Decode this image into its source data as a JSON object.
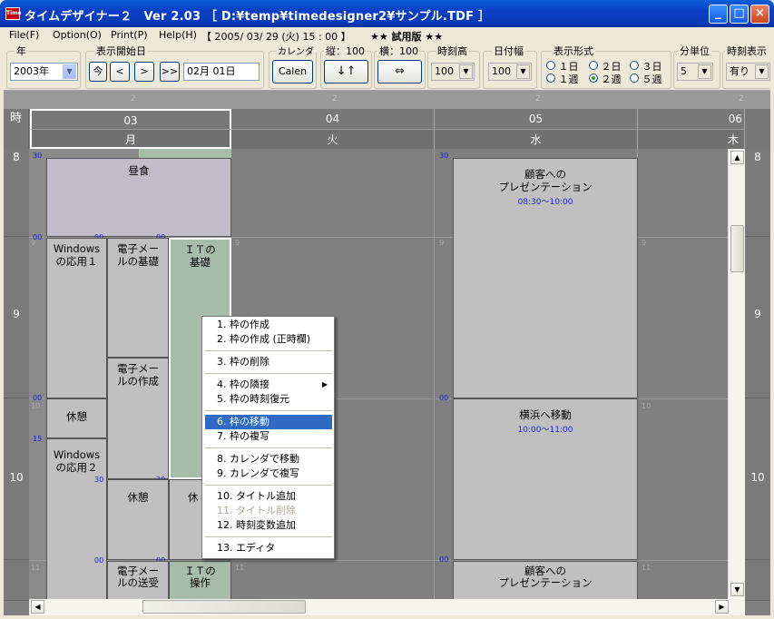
{
  "window": {
    "title": "タイムデザイナー２　Ver 2.03 ［ D:¥temp¥timedesigner2¥サンプル.TDF ］",
    "icon_text": "Time"
  },
  "menu": {
    "file": "File(F)",
    "option": "Option(O)",
    "print": "Print(P)",
    "help": "Help(H)",
    "datetime": "【 2005/ 03/ 29 (火) 15 : 00 】",
    "trial": "★★ 試用版 ★★"
  },
  "toolbar": {
    "year_label": "年",
    "year_value": "2003年",
    "start_label": "表示開始日",
    "today_btn": "今",
    "prev_btn": "<",
    "next_btn": ">",
    "jump_btn": ">>",
    "start_value": "02月 01日",
    "calendar_label": "カレンダ",
    "calendar_btn": "Calen",
    "vertical_label": "縦：100",
    "vertical_btn": "↓↑",
    "horizontal_label": "横：100",
    "horizontal_btn": "⇔",
    "timeheight_label": "時刻高",
    "timeheight_value": "100",
    "datewidth_label": "日付幅",
    "datewidth_value": "100",
    "display_label": "表示形式",
    "opt_1day": "１日",
    "opt_2day": "２日",
    "opt_3day": "３日",
    "opt_1week": "１週",
    "opt_2week": "２週",
    "opt_5week": "５週",
    "unit_label": "分単位",
    "unit_value": "5",
    "timedisp_label": "時刻表示",
    "timedisp_value": "有り"
  },
  "schedule": {
    "top_nums": [
      "2",
      "2",
      "2",
      "2"
    ],
    "hour_head": "時",
    "days": [
      {
        "date": "03",
        "weekday": "月"
      },
      {
        "date": "04",
        "weekday": "火"
      },
      {
        "date": "05",
        "weekday": "水"
      },
      {
        "date": "06",
        "weekday": "木"
      }
    ],
    "hours": [
      "8",
      "9",
      "10",
      "11"
    ],
    "minute_labels": {
      "m30": "30",
      "m00": "00",
      "m15": "15",
      "h9": "9",
      "h10": "10",
      "h11": "11"
    },
    "blocks": {
      "lunch": "昼食",
      "windows1": "Windows\nの応用１",
      "email_basic": "電子メー\nルの基礎",
      "it_basic": "ＩＴの\n基礎",
      "email_create": "電子メー\nルの作成",
      "rest1": "休憩",
      "windows2": "Windows\nの応用２",
      "rest2": "休憩",
      "rest3": "休",
      "email_send": "電子メー\nルの送受",
      "it_op": "ＩＴの\n操作",
      "present1": "顧客への\nプレゼンテーション",
      "present1_time": "08:30～10:00",
      "yokohama": "横浜へ移動",
      "yokohama_time": "10:00～11:00",
      "present2": "顧客への\nプレゼンテーション"
    }
  },
  "context_menu": [
    {
      "label": "1. 枠の作成"
    },
    {
      "label": "2. 枠の作成 (正時欄)"
    },
    {
      "label": "3. 枠の削除"
    },
    {
      "label": "4. 枠の隣接"
    },
    {
      "label": "5. 枠の時刻復元"
    },
    {
      "label": "6. 枠の移動"
    },
    {
      "label": "7. 枠の複写"
    },
    {
      "label": "8. カレンダで移動"
    },
    {
      "label": "9. カレンダで複写"
    },
    {
      "label": "10. タイトル追加"
    },
    {
      "label": "11. タイトル削除"
    },
    {
      "label": "12. 時刻変数追加"
    },
    {
      "label": "13. エディタ"
    }
  ],
  "colors": {
    "titlebar": "#0a46d0",
    "selected": "#316ac5",
    "lunch_block": "#c0bcc8",
    "it_block": "#a8bcac",
    "gray_block": "#c0c0c0"
  }
}
